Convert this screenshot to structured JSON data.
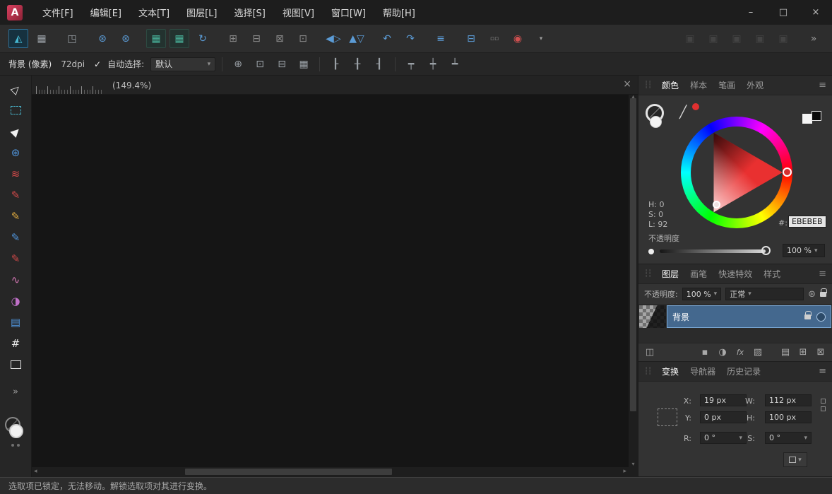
{
  "titlebar": {
    "logo_letter": "A",
    "menus": [
      {
        "name": "menu-file",
        "label": "文件[F]"
      },
      {
        "name": "menu-edit",
        "label": "编辑[E]"
      },
      {
        "name": "menu-text",
        "label": "文本[T]"
      },
      {
        "name": "menu-layer",
        "label": "图层[L]"
      },
      {
        "name": "menu-select",
        "label": "选择[S]"
      },
      {
        "name": "menu-view",
        "label": "视图[V]"
      },
      {
        "name": "menu-window",
        "label": "窗口[W]"
      },
      {
        "name": "menu-help",
        "label": "帮助[H]"
      }
    ],
    "window": {
      "minimize": "–",
      "maximize": "□",
      "close": "×"
    }
  },
  "toolbar": {
    "g_personas": [
      {
        "name": "photo-persona-button",
        "glyph": "◭",
        "color": "#45b6cf",
        "cls": "active"
      },
      {
        "name": "liquify-persona-button",
        "glyph": "▦",
        "color": "#9aa0a6"
      }
    ],
    "g_export": [
      {
        "name": "export-persona-button",
        "glyph": "◳",
        "color": "#9aa0a6"
      }
    ],
    "g_develop": [
      {
        "name": "develop-persona-button",
        "glyph": "⊛",
        "color": "#5b9bd5"
      },
      {
        "name": "tone-mapping-persona-button",
        "glyph": "⊛",
        "color": "#5b9bd5"
      }
    ],
    "g_snapping": [
      {
        "name": "snapping-toggle-button",
        "glyph": "▦",
        "color": "#49b39b",
        "cls": "active-subtle"
      },
      {
        "name": "pixel-grid-toggle-button",
        "glyph": "▦",
        "color": "#49b39b",
        "cls": "active-subtle"
      },
      {
        "name": "rotate-canvas-button",
        "glyph": "↻",
        "color": "#5b9bd5"
      }
    ],
    "g_modes": [
      {
        "name": "snapshot-button",
        "glyph": "⊞",
        "color": "#8a8a8a"
      },
      {
        "name": "auto-select-mode-button",
        "glyph": "⊟",
        "color": "#8a8a8a"
      },
      {
        "name": "edit-all-layers-button",
        "glyph": "⊠",
        "color": "#8a8a8a"
      },
      {
        "name": "preview-mode-button",
        "glyph": "⊡",
        "color": "#8a8a8a"
      }
    ],
    "g_flip": [
      {
        "name": "flip-horizontal-button",
        "glyph": "◀▷",
        "color": "#5b9bd5"
      },
      {
        "name": "flip-vertical-button",
        "glyph": "▲▽",
        "color": "#5b9bd5"
      }
    ],
    "g_rotate": [
      {
        "name": "rotate-ccw-button",
        "glyph": "↶",
        "color": "#5b9bd5"
      },
      {
        "name": "rotate-cw-button",
        "glyph": "↷",
        "color": "#5b9bd5"
      }
    ],
    "g_align": [
      {
        "name": "alignment-button",
        "glyph": "≡",
        "color": "#5b9bd5"
      }
    ],
    "g_insert": [
      {
        "name": "insert-behavior-button",
        "glyph": "⊟",
        "color": "#5b9bd5"
      },
      {
        "name": "insert-target-button",
        "glyph": "▫▫",
        "color": "#8a8a8a",
        "cls": "small"
      },
      {
        "name": "assistant-button",
        "glyph": "◉",
        "color": "#d05050"
      },
      {
        "name": "assistant-dropdown-chevron",
        "glyph": "▾",
        "color": "#9a9a9a",
        "cls": "small"
      }
    ],
    "g_disabled": [
      {
        "name": "studio-toggle-1-button",
        "glyph": "▣",
        "color": "#5a5a5a",
        "cls": "disabled"
      },
      {
        "name": "studio-toggle-2-button",
        "glyph": "▣",
        "color": "#5a5a5a",
        "cls": "disabled"
      },
      {
        "name": "studio-toggle-3-button",
        "glyph": "▣",
        "color": "#5a5a5a",
        "cls": "disabled"
      },
      {
        "name": "studio-toggle-4-button",
        "glyph": "▣",
        "color": "#5a5a5a",
        "cls": "disabled"
      },
      {
        "name": "studio-toggle-5-button",
        "glyph": "▣",
        "color": "#5a5a5a",
        "cls": "disabled"
      }
    ],
    "g_overflow": [
      {
        "name": "toolbar-overflow-button",
        "glyph": "»",
        "color": "#9a9a9a"
      }
    ]
  },
  "context": {
    "selection_label": "背景 (像素)",
    "dpi_label": "72dpi",
    "autoselect_check": "✓",
    "autoselect_label": "自动选择:",
    "autoselect_value": "默认",
    "chevron": "▾",
    "icons_snap": [
      {
        "name": "cycle-selection-box-button",
        "glyph": "⊕"
      },
      {
        "name": "snap-to-bounds-button",
        "glyph": "⊡"
      },
      {
        "name": "snap-to-middle-button",
        "glyph": "⊟"
      },
      {
        "name": "show-grid-button",
        "glyph": "▦"
      }
    ],
    "icons_align_h": [
      {
        "name": "align-left-button",
        "glyph": "┠"
      },
      {
        "name": "align-center-button",
        "glyph": "╂"
      },
      {
        "name": "align-right-button",
        "glyph": "┨"
      }
    ],
    "icons_align_v": [
      {
        "name": "align-top-button",
        "glyph": "┯"
      },
      {
        "name": "align-middle-button",
        "glyph": "┿"
      },
      {
        "name": "align-bottom-button",
        "glyph": "┷"
      }
    ]
  },
  "tools": {
    "items": [
      {
        "name": "move-tool-button",
        "glyph": "▷",
        "color": "#e6e6e6",
        "cls": "rot-ne"
      },
      {
        "name": "marquee-select-tool-button",
        "glyph": "",
        "color": "#49b3c9",
        "cls": "box-dashed"
      },
      {
        "name": "node-select-tool-button",
        "glyph": "▶",
        "color": "#f0f0f0",
        "cls": "rot-ne"
      },
      {
        "name": "selection-brush-tool-button",
        "glyph": "⊛",
        "color": "#4f93d9"
      },
      {
        "name": "flood-select-tool-button",
        "glyph": "≋",
        "color": "#cc4848"
      },
      {
        "name": "pen-tool-button",
        "glyph": "✎",
        "color": "#cc4848"
      },
      {
        "name": "pencil-tool-button",
        "glyph": "✎",
        "color": "#d9a63f"
      },
      {
        "name": "paint-brush-tool-button",
        "glyph": "✎",
        "color": "#4f93d9"
      },
      {
        "name": "pixel-brush-tool-button",
        "glyph": "✎",
        "color": "#cc4848"
      },
      {
        "name": "smudge-tool-button",
        "glyph": "∿",
        "color": "#d979b8"
      },
      {
        "name": "dodge-burn-tool-button",
        "glyph": "◑",
        "color": "#c070c8"
      },
      {
        "name": "gradient-tool-button",
        "glyph": "▤",
        "color": "#4f93d9"
      },
      {
        "name": "crop-tool-button",
        "glyph": "#",
        "color": "#e6e6e6"
      },
      {
        "name": "shape-tool-button",
        "glyph": "",
        "color": "#e6e6e6",
        "cls": "box-solid"
      }
    ],
    "expand": "»"
  },
  "canvas": {
    "tab_label": "(149.4%)",
    "close": "×",
    "scroll_up": "▴",
    "scroll_down": "▾",
    "scroll_left": "◂",
    "scroll_right": "▸"
  },
  "color_panel": {
    "grip": "┆┆",
    "menu_icon": "≡",
    "tabs": [
      {
        "name": "tab-color",
        "label": "颜色",
        "cls": "active"
      },
      {
        "name": "tab-swatches",
        "label": "样本"
      },
      {
        "name": "tab-stroke",
        "label": "笔画"
      },
      {
        "name": "tab-appearance",
        "label": "外观"
      }
    ],
    "dropper_glyph": "╱",
    "h": "H: 0",
    "s": "S: 0",
    "l": "L: 92",
    "hex_label": "#:",
    "hex_value": "EBEBEB",
    "opacity_label": "不透明度",
    "opacity_value": "100 %",
    "chevron": "▾",
    "wheel_hue_hex": "#E93030",
    "selected_hex": "#EBEBEB"
  },
  "layers_panel": {
    "grip": "┆┆",
    "menu_icon": "≡",
    "tabs": [
      {
        "name": "tab-layers",
        "label": "图层",
        "cls": "active"
      },
      {
        "name": "tab-brushes",
        "label": "画笔"
      },
      {
        "name": "tab-live-filters",
        "label": "快速特效"
      },
      {
        "name": "tab-styles",
        "label": "样式"
      }
    ],
    "opacity_label": "不透明度:",
    "opacity_value": "100 %",
    "blend_value": "正常",
    "chevron": "▾",
    "gear_glyph": "⊛",
    "layer_name": "背景",
    "selection_color": "#44688E",
    "ops_left": [
      {
        "name": "duplicate-layer-button",
        "glyph": "◫"
      }
    ],
    "ops_right": [
      {
        "name": "fill-layer-button",
        "glyph": "▪"
      },
      {
        "name": "adjustment-layer-button",
        "glyph": "◑"
      },
      {
        "name": "layer-effects-button",
        "glyph": "fx",
        "cls": "txt"
      },
      {
        "name": "mask-layer-button",
        "glyph": "▨"
      },
      {
        "name": "new-pixel-layer-button",
        "glyph": "▤",
        "cls": "gap-left"
      },
      {
        "name": "new-layer-button",
        "glyph": "⊞"
      },
      {
        "name": "delete-layer-button",
        "glyph": "⊠"
      }
    ]
  },
  "transform_panel": {
    "grip": "┆┆",
    "menu_icon": "≡",
    "tabs": [
      {
        "name": "tab-transform",
        "label": "变换",
        "cls": "active"
      },
      {
        "name": "tab-navigator",
        "label": "导航器"
      },
      {
        "name": "tab-history",
        "label": "历史记录"
      }
    ],
    "x_label": "X:",
    "x_value": "19 px",
    "y_label": "Y:",
    "y_value": "0 px",
    "w_label": "W:",
    "w_value": "112 px",
    "h_label": "H:",
    "h_value": "100 px",
    "r_label": "R:",
    "r_value": "0 °",
    "s_label": "S:",
    "s_value": "0 °",
    "chevron": "▾"
  },
  "statusbar": {
    "message": "选取项已锁定，无法移动。解锁选取项对其进行变换。"
  }
}
